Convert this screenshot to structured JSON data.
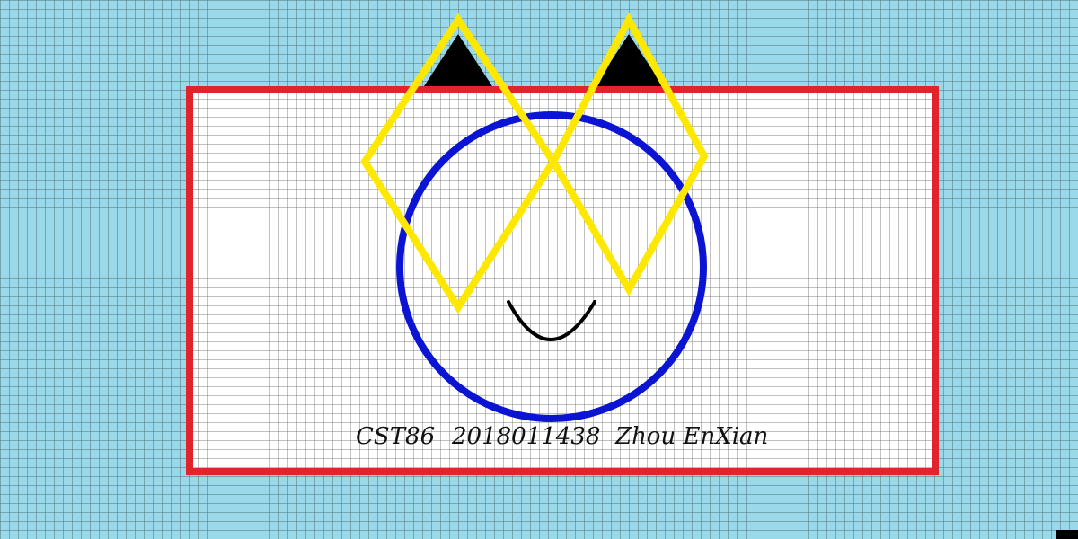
{
  "caption": {
    "course": "CST86",
    "student_id": "2018011438",
    "name": "Zhou EnXian"
  },
  "colors": {
    "background": "#9ad9e9",
    "grid_line": "#1a1a1a",
    "frame": "#e2232b",
    "panel": "#ffffff",
    "diamond": "#ffe800",
    "ear_fill": "#000000",
    "circle": "#0a14d2",
    "mouth": "#000000"
  },
  "shapes": {
    "frame": "rectangle",
    "ears": "yellow-diamonds",
    "face": "blue-circle",
    "mouth": "smile-curve"
  }
}
